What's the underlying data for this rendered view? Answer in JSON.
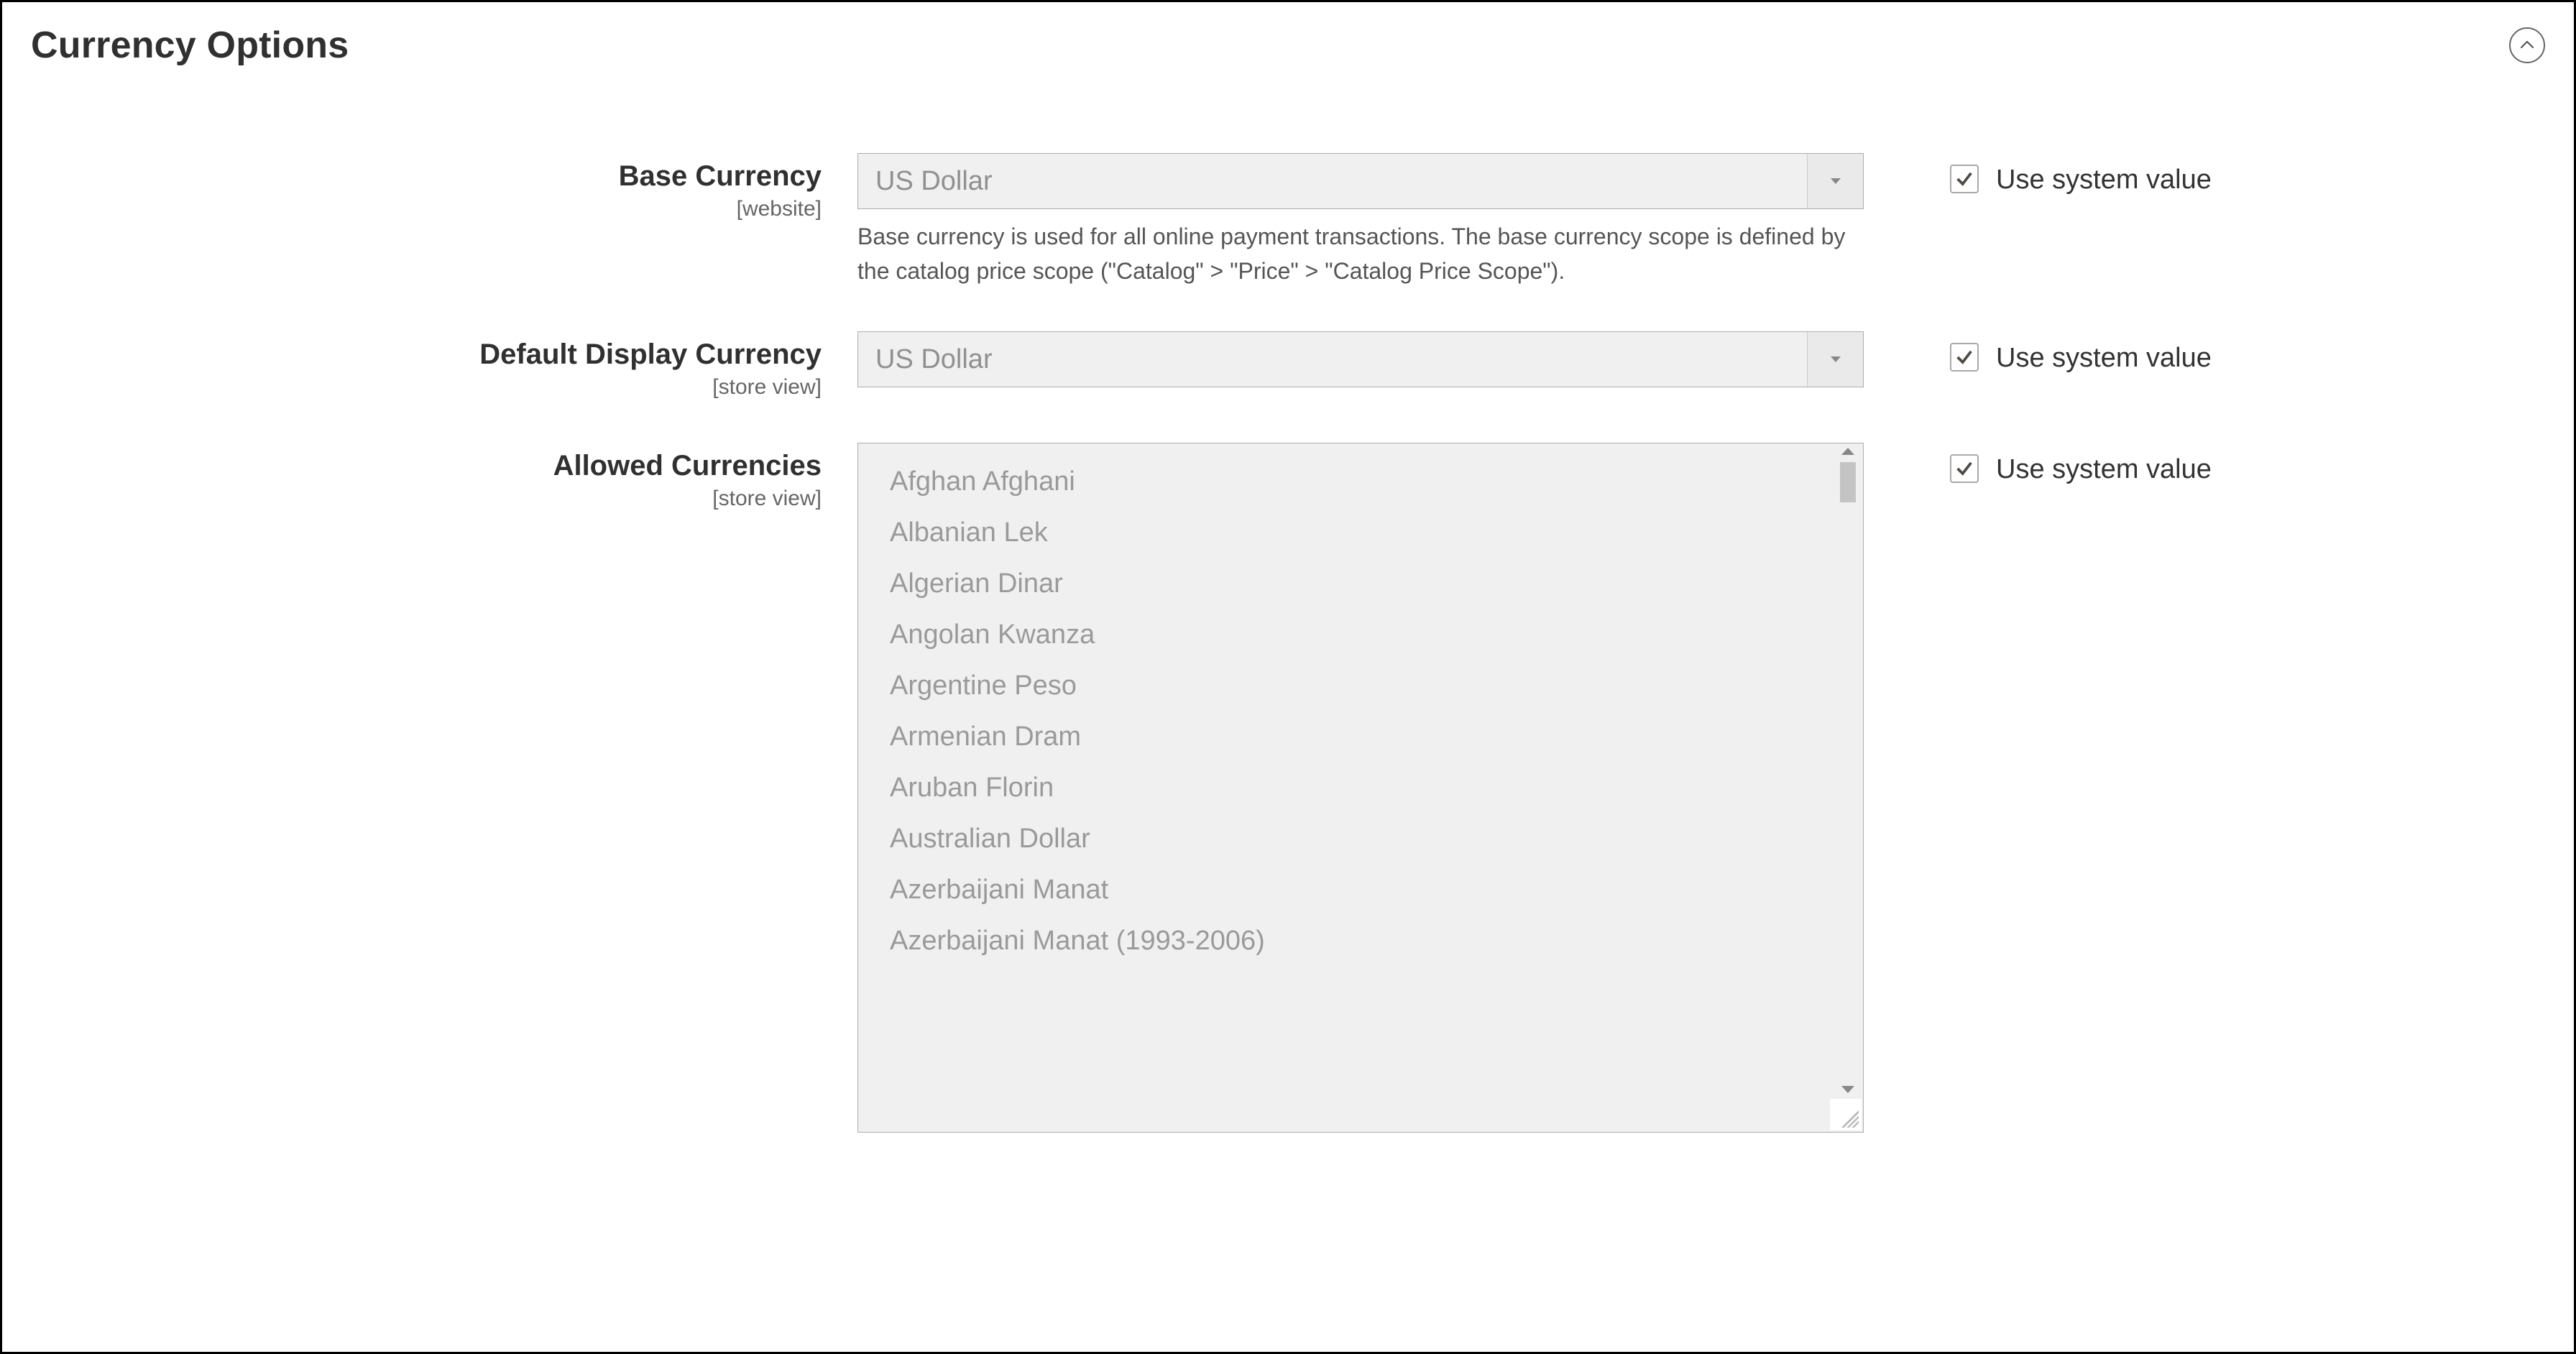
{
  "section": {
    "title": "Currency Options"
  },
  "fields": {
    "base_currency": {
      "label": "Base Currency",
      "scope": "[website]",
      "value": "US Dollar",
      "note": "Base currency is used for all online payment transactions. The base currency scope is defined by the catalog price scope (\"Catalog\" > \"Price\" > \"Catalog Price Scope\").",
      "use_system_label": "Use system value",
      "use_system_checked": true
    },
    "default_display_currency": {
      "label": "Default Display Currency",
      "scope": "[store view]",
      "value": "US Dollar",
      "use_system_label": "Use system value",
      "use_system_checked": true
    },
    "allowed_currencies": {
      "label": "Allowed Currencies",
      "scope": "[store view]",
      "options": [
        "Afghan Afghani",
        "Albanian Lek",
        "Algerian Dinar",
        "Angolan Kwanza",
        "Argentine Peso",
        "Armenian Dram",
        "Aruban Florin",
        "Australian Dollar",
        "Azerbaijani Manat",
        "Azerbaijani Manat (1993-2006)"
      ],
      "use_system_label": "Use system value",
      "use_system_checked": true
    }
  }
}
